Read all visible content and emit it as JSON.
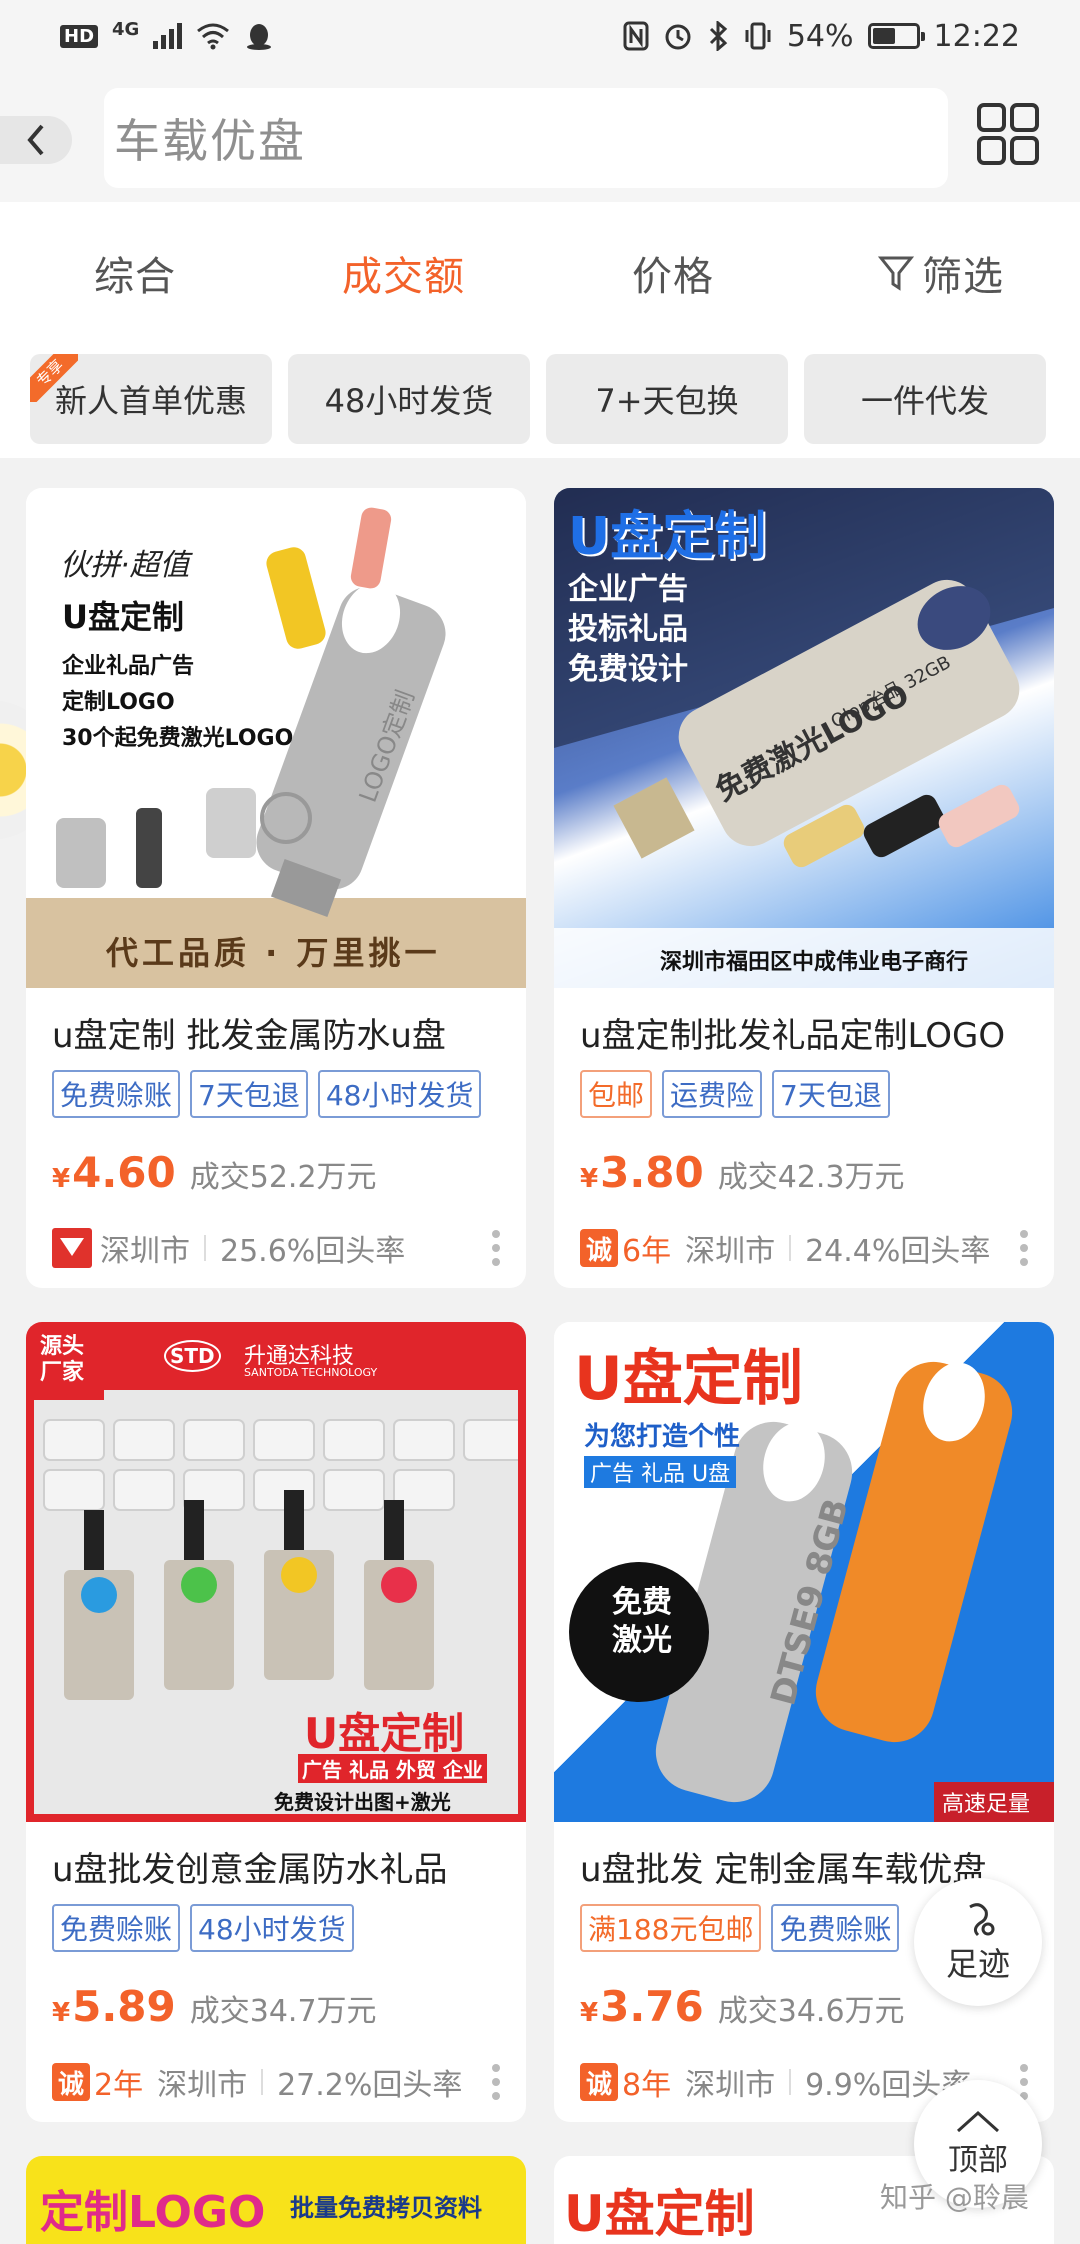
{
  "status_bar": {
    "hd": "HD",
    "network": "4G",
    "battery_percent": "54%",
    "battery_level": 0.54,
    "time": "12:22"
  },
  "header": {
    "search_text": "车载优盘"
  },
  "sort_tabs": [
    {
      "label": "综合",
      "active": false
    },
    {
      "label": "成交额",
      "active": true
    },
    {
      "label": "价格",
      "active": false
    },
    {
      "label": "筛选",
      "active": false
    }
  ],
  "chips": {
    "ribbon": "专享",
    "items": [
      "新人首单优惠",
      "48小时发货",
      "7+天包换",
      "一件代发"
    ]
  },
  "products": [
    {
      "title": "u盘定制 批发金属防水u盘",
      "tags": [
        {
          "text": "免费赊账",
          "style": "blue"
        },
        {
          "text": "7天包退",
          "style": "blue"
        },
        {
          "text": "48小时发货",
          "style": "blue"
        }
      ],
      "currency": "¥",
      "price": "4.60",
      "sales": "成交52.2万元",
      "years": "",
      "location": "深圳市",
      "repeat_rate": "25.6%回头率",
      "image_texts": [
        "伙拼·超值",
        "U盘定制",
        "企业礼品广告",
        "定制LOGO",
        "30个起免费激光LOGO",
        "代工品质 · 万里挑一",
        "LOGO定制"
      ]
    },
    {
      "title": "u盘定制批发礼品定制LOGO",
      "tags": [
        {
          "text": "包邮",
          "style": "orange"
        },
        {
          "text": "运费险",
          "style": "blue"
        },
        {
          "text": "7天包退",
          "style": "blue"
        }
      ],
      "currency": "¥",
      "price": "3.80",
      "sales": "成交42.3万元",
      "years": "6年",
      "location": "深圳市",
      "repeat_rate": "24.4%回头率",
      "image_texts": [
        "U盘定制",
        "企业广告",
        "投标礼品",
        "免费设计",
        "免费激光LOGO",
        "Qlop治品 32GB",
        "深圳市福田区中成伟业电子商行"
      ]
    },
    {
      "title": "u盘批发创意金属防水礼品",
      "tags": [
        {
          "text": "免费赊账",
          "style": "blue"
        },
        {
          "text": "48小时发货",
          "style": "blue"
        }
      ],
      "currency": "¥",
      "price": "5.89",
      "sales": "成交34.7万元",
      "years": "2年",
      "location": "深圳市",
      "repeat_rate": "27.2%回头率",
      "image_texts": [
        "源头厂家",
        "STD",
        "升通达科技",
        "SANTODA TECHNOLOGY",
        "U盘定制",
        "广告 礼品 外贸 企业",
        "免费设计出图+激光"
      ]
    },
    {
      "title": "u盘批发 定制金属车载优盘",
      "tags": [
        {
          "text": "满188元包邮",
          "style": "orange"
        },
        {
          "text": "免费赊账",
          "style": "blue"
        }
      ],
      "currency": "¥",
      "price": "3.76",
      "sales": "成交34.6万元",
      "years": "8年",
      "location": "深圳市",
      "repeat_rate": "9.9%回头率",
      "image_texts": [
        "U盘定制",
        "为您打造个性",
        "广告 礼品 U盘",
        "免费激光",
        "DTSE9 8GB",
        "高速足量"
      ]
    }
  ],
  "bottom_banners": [
    "定制LOGO",
    "批量免费拷贝资料",
    "U盘定制"
  ],
  "floating": {
    "footprint": "足迹",
    "top": "顶部"
  },
  "cheng_badge": "诚",
  "watermark": "知乎 @聆晨"
}
